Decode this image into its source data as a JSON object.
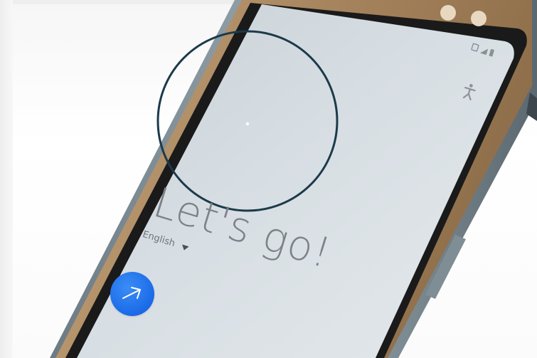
{
  "setup_screen": {
    "headline": "Let's go!",
    "language": {
      "selected": "English",
      "dropdown_icon": "caret-down-icon"
    },
    "next_button_icon": "arrow-right-icon"
  },
  "status_bar_icons": [
    "nfc-icon",
    "signal-icon",
    "battery-icon"
  ],
  "accessibility_icon": "accessibility-icon",
  "colors": {
    "screen": "#d6dde2",
    "bezel": "#b08e66",
    "next_button": "#1b6ae8",
    "highlight_circle": "#1c3a4a"
  }
}
